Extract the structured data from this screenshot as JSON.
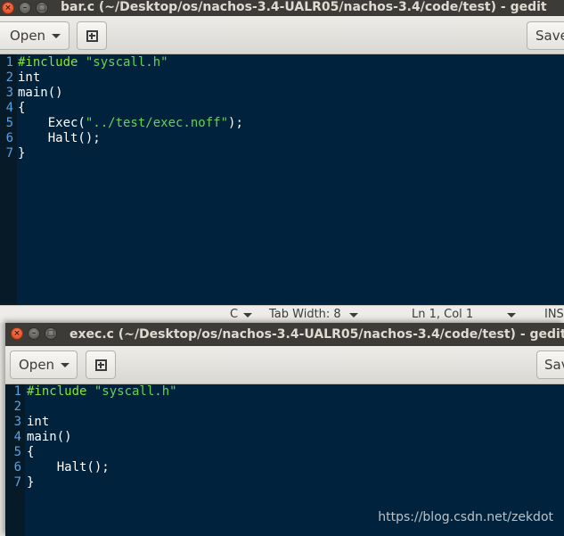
{
  "window1": {
    "title": "bar.c (~/Desktop/os/nachos-3.4-UALR05/nachos-3.4/code/test) - gedit",
    "open_label": "Open",
    "save_label": "Save",
    "close_glyph": "×",
    "min_glyph": "–",
    "max_glyph": "□",
    "lines": [
      {
        "num": "1",
        "segments": [
          {
            "t": "#include ",
            "c": "pp"
          },
          {
            "t": "\"syscall.h\"",
            "c": "str"
          }
        ]
      },
      {
        "num": "2",
        "segments": [
          {
            "t": "int",
            "c": "norm"
          }
        ]
      },
      {
        "num": "3",
        "segments": [
          {
            "t": "main()",
            "c": "norm"
          }
        ]
      },
      {
        "num": "4",
        "segments": [
          {
            "t": "{",
            "c": "norm"
          }
        ]
      },
      {
        "num": "5",
        "segments": [
          {
            "t": "    Exec(",
            "c": "norm"
          },
          {
            "t": "\"../test/exec.noff\"",
            "c": "str"
          },
          {
            "t": ");",
            "c": "norm"
          }
        ]
      },
      {
        "num": "6",
        "segments": [
          {
            "t": "    Halt();",
            "c": "norm"
          }
        ]
      },
      {
        "num": "7",
        "segments": [
          {
            "t": "}",
            "c": "norm"
          }
        ]
      }
    ],
    "status": {
      "language": "C",
      "tab_width": "Tab Width: 8",
      "position": "Ln 1, Col 1",
      "mode": "INS"
    }
  },
  "window2": {
    "title": "exec.c (~/Desktop/os/nachos-3.4-UALR05/nachos-3.4/code/test) - gedit",
    "open_label": "Open",
    "save_label": "Save",
    "close_glyph": "×",
    "min_glyph": "–",
    "max_glyph": "□",
    "lines": [
      {
        "num": "1",
        "segments": [
          {
            "t": "#include ",
            "c": "pp"
          },
          {
            "t": "\"syscall.h\"",
            "c": "str"
          }
        ]
      },
      {
        "num": "2",
        "segments": []
      },
      {
        "num": "3",
        "segments": [
          {
            "t": "int",
            "c": "norm"
          }
        ]
      },
      {
        "num": "4",
        "segments": [
          {
            "t": "main()",
            "c": "norm"
          }
        ]
      },
      {
        "num": "5",
        "segments": [
          {
            "t": "{",
            "c": "norm"
          }
        ]
      },
      {
        "num": "6",
        "segments": [
          {
            "t": "    Halt();",
            "c": "norm"
          }
        ]
      },
      {
        "num": "7",
        "segments": [
          {
            "t": "}",
            "c": "norm"
          }
        ]
      }
    ]
  },
  "watermark": "https://blog.csdn.net/zekdot"
}
